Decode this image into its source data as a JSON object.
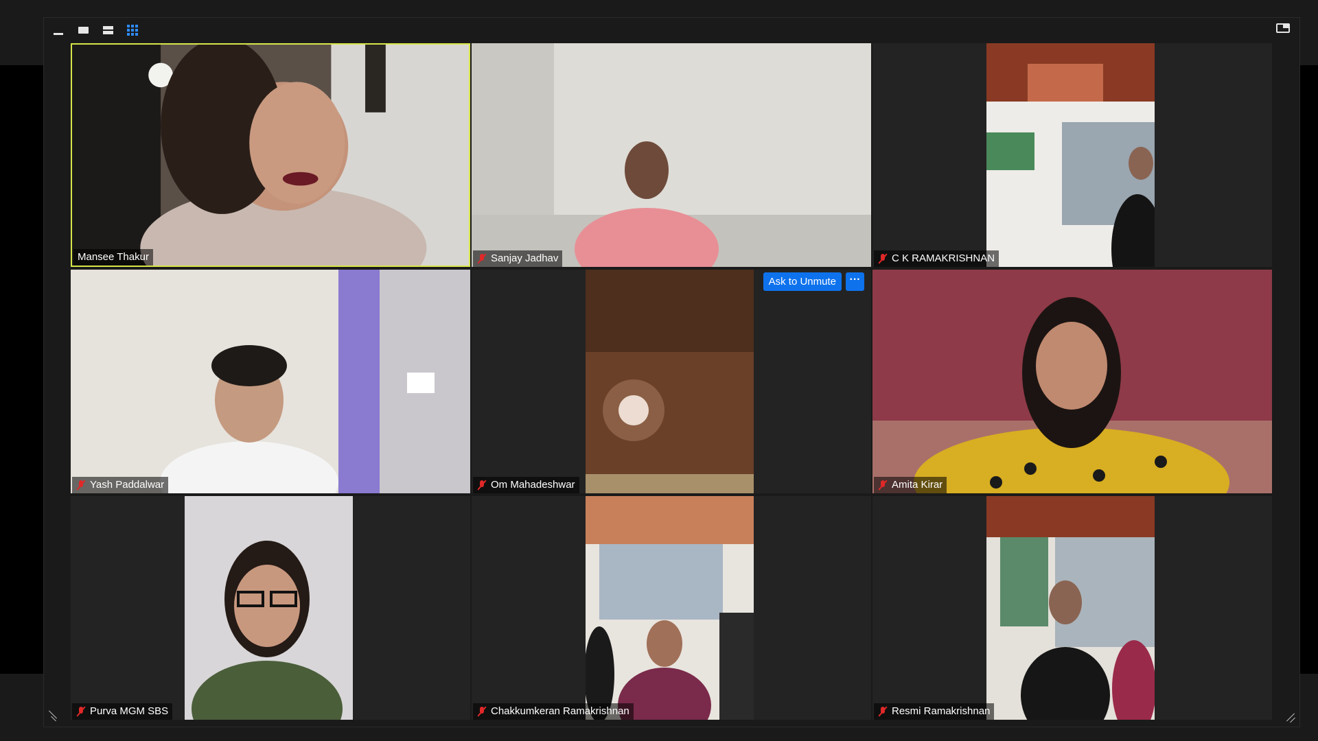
{
  "view_controls": {
    "minimize_icon": "minimize-icon",
    "speaker_view_icon": "speaker-view-icon",
    "strip_view_icon": "strip-view-icon",
    "gallery_view_icon": "gallery-view-icon",
    "layout_icon": "layout-icon"
  },
  "colors": {
    "active_speaker_border": "#d8e64a",
    "muted_icon": "#e02828",
    "primary_button": "#0e72ed",
    "gallery_icon": "#2d8cff",
    "tile_background": "#232323"
  },
  "hover_actions": {
    "ask_to_unmute": "Ask to Unmute",
    "more": "···"
  },
  "participants": [
    {
      "name": "Mansee Thakur",
      "muted": false,
      "active_speaker": true
    },
    {
      "name": "Sanjay Jadhav",
      "muted": true
    },
    {
      "name": "C K RAMAKRISHNAN",
      "muted": true
    },
    {
      "name": "Yash Paddalwar",
      "muted": true
    },
    {
      "name": "Om Mahadeshwar",
      "muted": true
    },
    {
      "name": "Amita Kirar",
      "muted": true
    },
    {
      "name": "Purva MGM SBS",
      "muted": true
    },
    {
      "name": "Chakkumkeran Ramakrishnan",
      "muted": true
    },
    {
      "name": "Resmi Ramakrishnan",
      "muted": true
    }
  ]
}
